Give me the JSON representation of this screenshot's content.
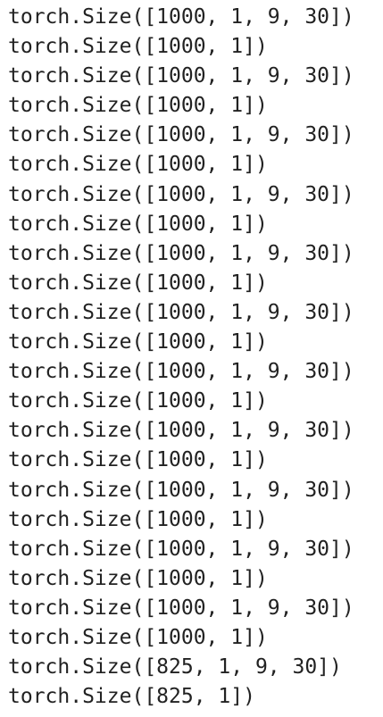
{
  "output": {
    "lines": [
      "torch.Size([1000, 1, 9, 30])",
      "torch.Size([1000, 1])",
      "torch.Size([1000, 1, 9, 30])",
      "torch.Size([1000, 1])",
      "torch.Size([1000, 1, 9, 30])",
      "torch.Size([1000, 1])",
      "torch.Size([1000, 1, 9, 30])",
      "torch.Size([1000, 1])",
      "torch.Size([1000, 1, 9, 30])",
      "torch.Size([1000, 1])",
      "torch.Size([1000, 1, 9, 30])",
      "torch.Size([1000, 1])",
      "torch.Size([1000, 1, 9, 30])",
      "torch.Size([1000, 1])",
      "torch.Size([1000, 1, 9, 30])",
      "torch.Size([1000, 1])",
      "torch.Size([1000, 1, 9, 30])",
      "torch.Size([1000, 1])",
      "torch.Size([1000, 1, 9, 30])",
      "torch.Size([1000, 1])",
      "torch.Size([1000, 1, 9, 30])",
      "torch.Size([1000, 1])",
      "torch.Size([825, 1, 9, 30])",
      "torch.Size([825, 1])"
    ]
  }
}
